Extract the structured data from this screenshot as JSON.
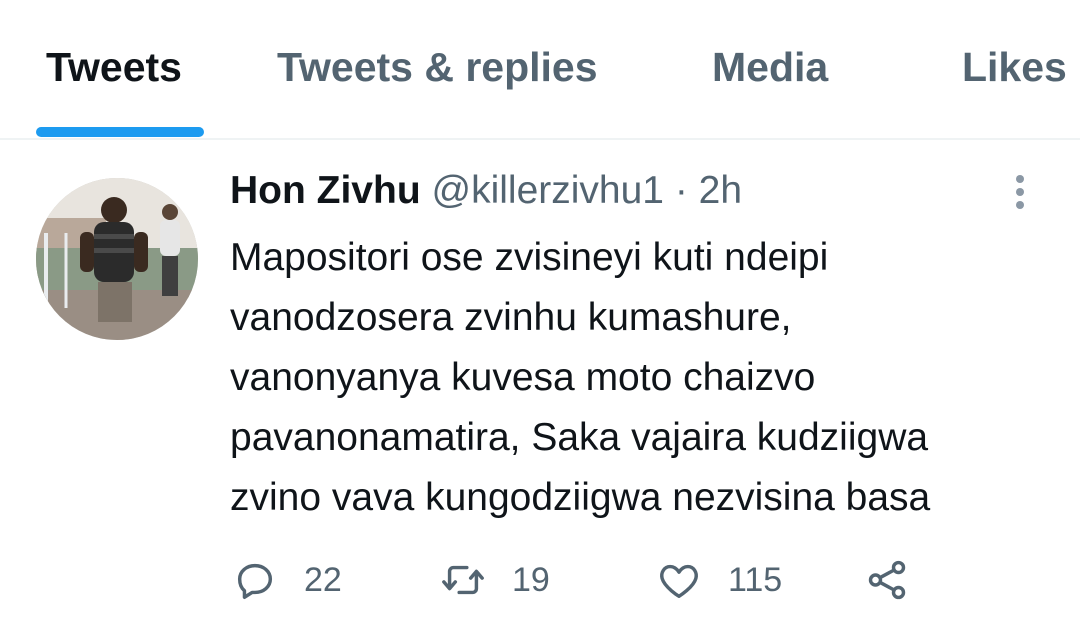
{
  "tabs": [
    {
      "label": "Tweets",
      "active": true
    },
    {
      "label": "Tweets & replies",
      "active": false
    },
    {
      "label": "Media",
      "active": false
    },
    {
      "label": "Likes",
      "active": false
    }
  ],
  "colors": {
    "accent": "#1d9bf0",
    "text_primary": "#0f1419",
    "text_secondary": "#536471"
  },
  "tweet": {
    "display_name": "Hon Zivhu",
    "handle": "@killerzivhu1",
    "separator": "·",
    "time": "2h",
    "text_lines": [
      "Mapositori ose zvisineyi kuti ndeipi",
      "vanodzosera zvinhu kumashure,",
      "vanonyanya kuvesa moto chaizvo",
      "pavanonamatira, Saka vajaira kudziigwa",
      "zvino vava kungodziigwa nezvisina basa"
    ],
    "actions": {
      "reply": {
        "icon": "reply-icon",
        "count": "22"
      },
      "retweet": {
        "icon": "retweet-icon",
        "count": "19"
      },
      "like": {
        "icon": "heart-icon",
        "count": "115"
      },
      "share": {
        "icon": "share-icon"
      }
    },
    "more_icon": "more-vertical-icon"
  }
}
